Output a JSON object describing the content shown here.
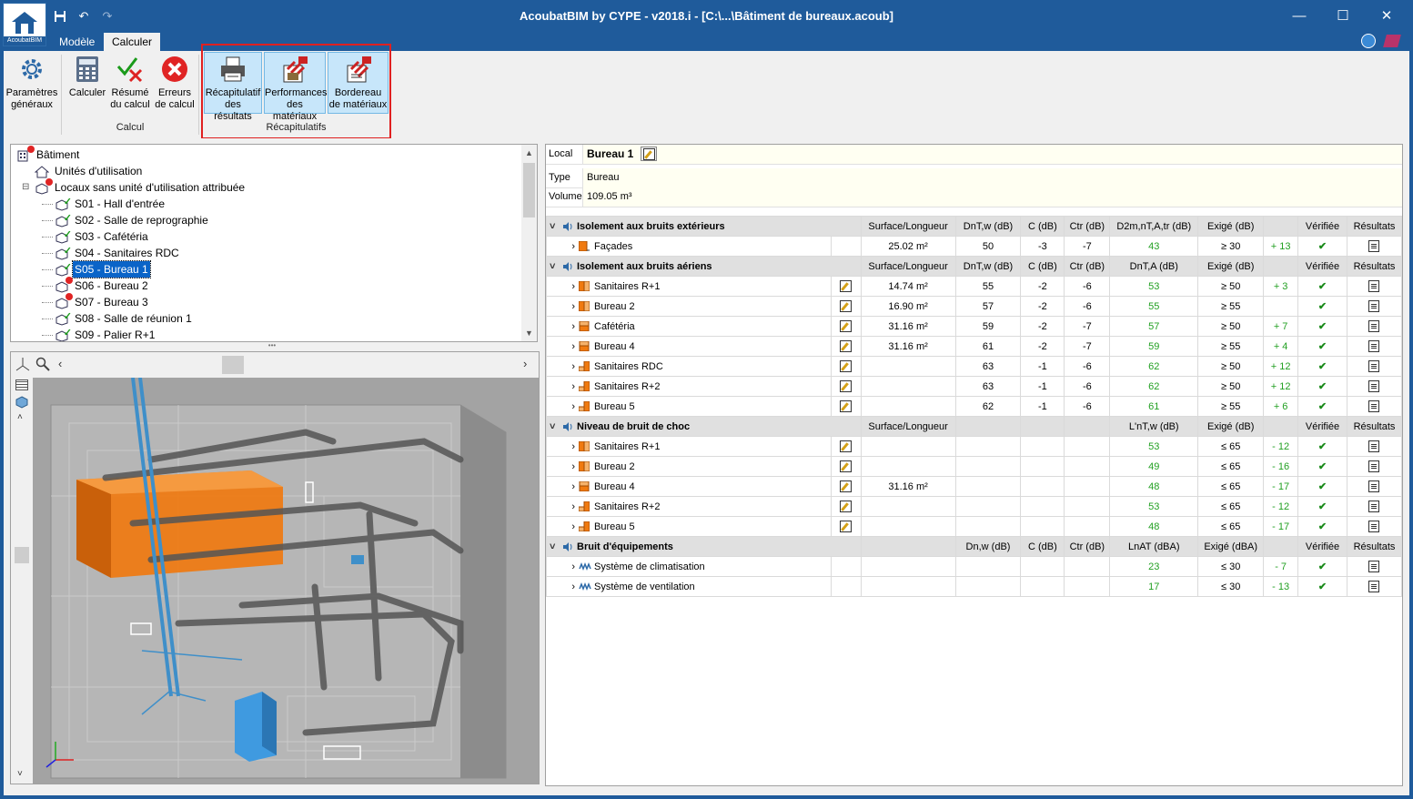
{
  "window": {
    "title": "AcoubatBIM by CYPE - v2018.i - [C:\\...\\Bâtiment de bureaux.acoub]",
    "logo_text": "AcoubatBIM"
  },
  "tabs": [
    {
      "label": "Modèle"
    },
    {
      "label": "Calculer"
    }
  ],
  "ribbon": {
    "buttons": [
      {
        "line1": "Paramètres",
        "line2": "généraux",
        "icon": "gear-icon"
      },
      {
        "line1": "Calculer",
        "line2": "",
        "icon": "calculator-icon"
      },
      {
        "line1": "Résumé",
        "line2": "du calcul",
        "icon": "check-cross-icon"
      },
      {
        "line1": "Erreurs",
        "line2": "de calcul",
        "icon": "error-icon"
      },
      {
        "line1": "Récapitulatif",
        "line2": "des résultats",
        "icon": "printer-icon"
      },
      {
        "line1": "Performances",
        "line2": "des matériaux",
        "icon": "material-performance-icon"
      },
      {
        "line1": "Bordereau",
        "line2": "de matériaux",
        "icon": "material-list-icon"
      }
    ],
    "groups": [
      "Calcul",
      "Récapitulatifs"
    ]
  },
  "tree": {
    "items": [
      {
        "label": "Bâtiment",
        "indent": 0,
        "status": "error"
      },
      {
        "label": "Unités d'utilisation",
        "indent": 1,
        "status": "none"
      },
      {
        "label": "Locaux sans unité d'utilisation attribuée",
        "indent": 1,
        "status": "error"
      },
      {
        "label": "S01 - Hall d'entrée",
        "indent": 2,
        "status": "ok"
      },
      {
        "label": "S02 - Salle de reprographie",
        "indent": 2,
        "status": "ok"
      },
      {
        "label": "S03 - Cafétéria",
        "indent": 2,
        "status": "ok"
      },
      {
        "label": "S04 - Sanitaires RDC",
        "indent": 2,
        "status": "ok"
      },
      {
        "label": "S05 - Bureau 1",
        "indent": 2,
        "status": "ok",
        "selected": true
      },
      {
        "label": "S06 - Bureau 2",
        "indent": 2,
        "status": "error"
      },
      {
        "label": "S07 - Bureau 3",
        "indent": 2,
        "status": "error"
      },
      {
        "label": "S08 - Salle de réunion 1",
        "indent": 2,
        "status": "ok"
      },
      {
        "label": "S09 - Palier R+1",
        "indent": 2,
        "status": "ok"
      }
    ]
  },
  "info": {
    "local_label": "Local",
    "local_value": "Bureau 1",
    "type_label": "Type",
    "type_value": "Bureau",
    "volume_label": "Volume",
    "volume_value": "109.05  m³"
  },
  "colors": {
    "title_bar": "#1f5b9b",
    "selection": "#0a64c8",
    "ok_green": "#23a023",
    "highlight_box": "#e02020",
    "ribbon_highlight": "#c7e6fa",
    "room_orange": "#f07a10"
  },
  "results": {
    "sections": [
      {
        "title": "Isolement aux bruits extérieurs",
        "icon": "speaker-icon",
        "headers": [
          "Surface/Longueur",
          "DnT,w (dB)",
          "C (dB)",
          "Ctr (dB)",
          "D2m,nT,A,tr (dB)",
          "Exigé (dB)",
          "",
          "Vérifiée",
          "Résultats"
        ],
        "rows": [
          {
            "name": "Façades",
            "swatch": "facade",
            "edit": false,
            "surface": "25.02 m²",
            "v1": "50",
            "c": "-3",
            "ctr": "-7",
            "res": "43",
            "req": "≥ 30",
            "margin": "+ 13"
          }
        ]
      },
      {
        "title": "Isolement aux bruits aériens",
        "icon": "speaker-icon",
        "headers": [
          "Surface/Longueur",
          "DnT,w (dB)",
          "C (dB)",
          "Ctr (dB)",
          "DnT,A (dB)",
          "Exigé (dB)",
          "",
          "Vérifiée",
          "Résultats"
        ],
        "rows": [
          {
            "name": "Sanitaires R+1",
            "swatch": "wall",
            "edit": true,
            "surface": "14.74 m²",
            "v1": "55",
            "c": "-2",
            "ctr": "-6",
            "res": "53",
            "req": "≥ 50",
            "margin": "+ 3"
          },
          {
            "name": "Bureau 2",
            "swatch": "wall",
            "edit": true,
            "surface": "16.90 m²",
            "v1": "57",
            "c": "-2",
            "ctr": "-6",
            "res": "55",
            "req": "≥ 55",
            "margin": ""
          },
          {
            "name": "Cafétéria",
            "swatch": "floor",
            "edit": true,
            "surface": "31.16 m²",
            "v1": "59",
            "c": "-2",
            "ctr": "-7",
            "res": "57",
            "req": "≥ 50",
            "margin": "+ 7"
          },
          {
            "name": "Bureau 4",
            "swatch": "floor",
            "edit": true,
            "surface": "31.16 m²",
            "v1": "61",
            "c": "-2",
            "ctr": "-7",
            "res": "59",
            "req": "≥ 55",
            "margin": "+ 4"
          },
          {
            "name": "Sanitaires RDC",
            "swatch": "corner",
            "edit": true,
            "surface": "",
            "v1": "63",
            "c": "-1",
            "ctr": "-6",
            "res": "62",
            "req": "≥ 50",
            "margin": "+ 12"
          },
          {
            "name": "Sanitaires R+2",
            "swatch": "corner",
            "edit": true,
            "surface": "",
            "v1": "63",
            "c": "-1",
            "ctr": "-6",
            "res": "62",
            "req": "≥ 50",
            "margin": "+ 12"
          },
          {
            "name": "Bureau 5",
            "swatch": "corner",
            "edit": true,
            "surface": "",
            "v1": "62",
            "c": "-1",
            "ctr": "-6",
            "res": "61",
            "req": "≥ 55",
            "margin": "+ 6"
          }
        ]
      },
      {
        "title": "Niveau de bruit de choc",
        "icon": "impact-icon",
        "headers": [
          "Surface/Longueur",
          "",
          "",
          "",
          "L'nT,w (dB)",
          "Exigé (dB)",
          "",
          "Vérifiée",
          "Résultats"
        ],
        "rows": [
          {
            "name": "Sanitaires R+1",
            "swatch": "wall",
            "edit": true,
            "surface": "",
            "v1": "",
            "c": "",
            "ctr": "",
            "res": "53",
            "req": "≤ 65",
            "margin": "- 12"
          },
          {
            "name": "Bureau 2",
            "swatch": "wall",
            "edit": true,
            "surface": "",
            "v1": "",
            "c": "",
            "ctr": "",
            "res": "49",
            "req": "≤ 65",
            "margin": "- 16"
          },
          {
            "name": "Bureau 4",
            "swatch": "floor",
            "edit": true,
            "surface": "31.16 m²",
            "v1": "",
            "c": "",
            "ctr": "",
            "res": "48",
            "req": "≤ 65",
            "margin": "- 17"
          },
          {
            "name": "Sanitaires R+2",
            "swatch": "corner",
            "edit": true,
            "surface": "",
            "v1": "",
            "c": "",
            "ctr": "",
            "res": "53",
            "req": "≤ 65",
            "margin": "- 12"
          },
          {
            "name": "Bureau 5",
            "swatch": "corner",
            "edit": true,
            "surface": "",
            "v1": "",
            "c": "",
            "ctr": "",
            "res": "48",
            "req": "≤ 65",
            "margin": "- 17"
          }
        ]
      },
      {
        "title": "Bruit d'équipements",
        "icon": "equipment-icon",
        "headers": [
          "",
          "Dn,w (dB)",
          "C (dB)",
          "Ctr (dB)",
          "LnAT (dBA)",
          "Exigé (dBA)",
          "",
          "Vérifiée",
          "Résultats"
        ],
        "rows": [
          {
            "name": "Système de climatisation",
            "swatch": "duct",
            "edit": false,
            "surface": "",
            "v1": "",
            "c": "",
            "ctr": "",
            "res": "23",
            "req": "≤ 30",
            "margin": "- 7"
          },
          {
            "name": "Système de ventilation",
            "swatch": "duct",
            "edit": false,
            "surface": "",
            "v1": "",
            "c": "",
            "ctr": "",
            "res": "17",
            "req": "≤ 30",
            "margin": "- 13"
          }
        ]
      }
    ]
  }
}
